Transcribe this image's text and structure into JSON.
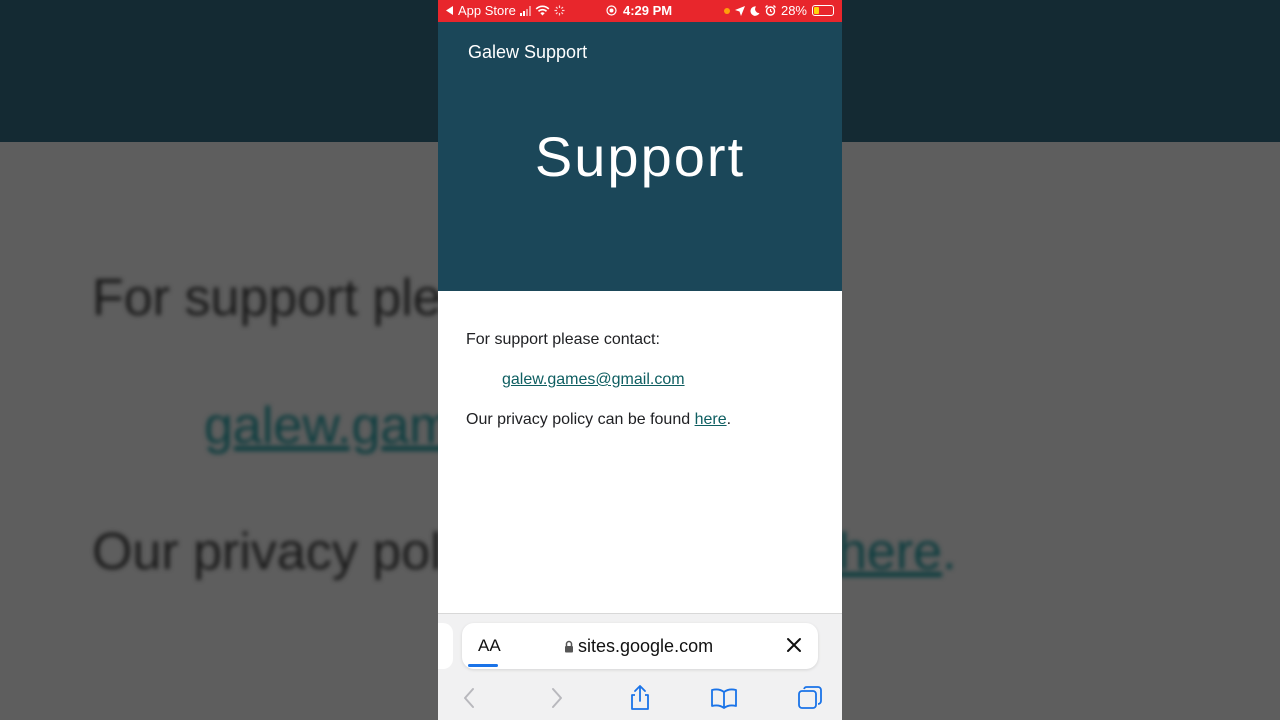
{
  "background_zoom": {
    "line1": "For support ple",
    "line2": "galew.gam",
    "line3": "Our privacy poli",
    "line4_link": "here",
    "line4_suffix": "."
  },
  "status_bar": {
    "back_app": "App Store",
    "time": "4:29 PM",
    "battery": "28%",
    "color": "#e8262c"
  },
  "site": {
    "name": "Galew Support",
    "title": "Support",
    "header_color": "#1b4759"
  },
  "content": {
    "contact_text": "For support please contact:",
    "email": "galew.games@gmail.com",
    "privacy_prefix": "Our privacy policy can be found ",
    "privacy_link": "here",
    "privacy_suffix": "."
  },
  "browser": {
    "text_size_label": "AA",
    "url": "sites.google.com",
    "icons": [
      "lock-icon",
      "close-icon",
      "back-icon",
      "forward-icon",
      "share-icon",
      "bookmarks-icon",
      "tabs-icon"
    ]
  }
}
